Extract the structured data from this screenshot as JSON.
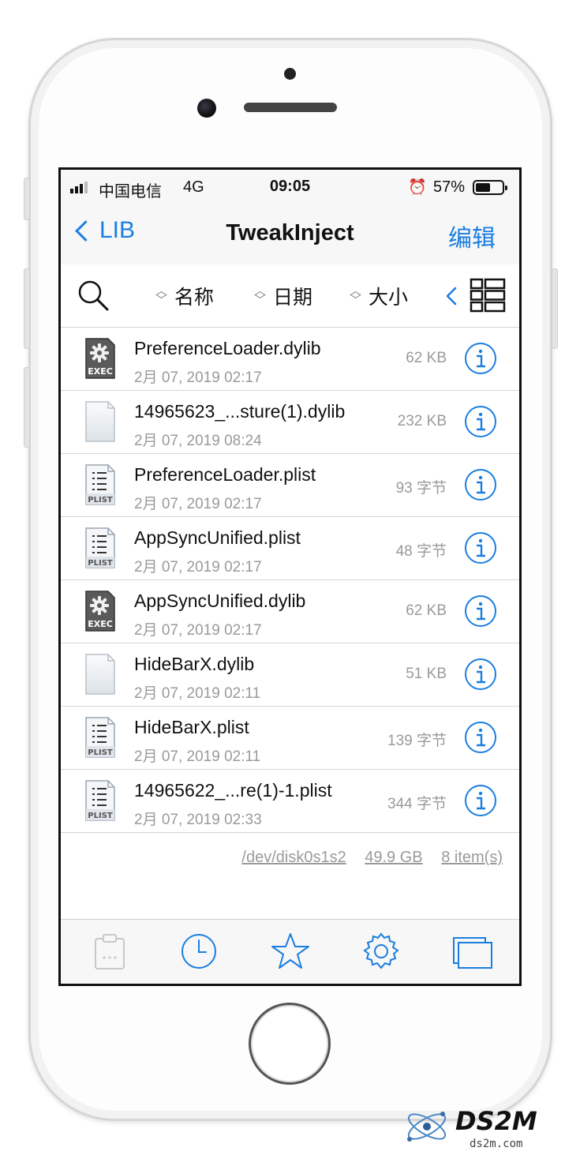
{
  "status_bar": {
    "carrier": "中国电信",
    "network": "4G",
    "time": "09:05",
    "alarm_icon": "alarm-clock-icon",
    "battery_percent": "57%",
    "battery_level": 0.57
  },
  "nav": {
    "back_label": "LIB",
    "title": "TweakInject",
    "edit_label": "编辑"
  },
  "toolbar": {
    "sort_name": "名称",
    "sort_date": "日期",
    "sort_size": "大小"
  },
  "files": [
    {
      "name": "PreferenceLoader.dylib",
      "date": "2月 07, 2019 02:17",
      "size": "62 KB",
      "icon": "exec-file-icon"
    },
    {
      "name": "14965623_...sture(1).dylib",
      "date": "2月 07, 2019 08:24",
      "size": "232 KB",
      "icon": "blank-file-icon"
    },
    {
      "name": "PreferenceLoader.plist",
      "date": "2月 07, 2019 02:17",
      "size": "93 字节",
      "icon": "plist-file-icon"
    },
    {
      "name": "AppSyncUnified.plist",
      "date": "2月 07, 2019 02:17",
      "size": "48 字节",
      "icon": "plist-file-icon"
    },
    {
      "name": "AppSyncUnified.dylib",
      "date": "2月 07, 2019 02:17",
      "size": "62 KB",
      "icon": "exec-file-icon"
    },
    {
      "name": "HideBarX.dylib",
      "date": "2月 07, 2019 02:11",
      "size": "51 KB",
      "icon": "blank-file-icon"
    },
    {
      "name": "HideBarX.plist",
      "date": "2月 07, 2019 02:11",
      "size": "139 字节",
      "icon": "plist-file-icon"
    },
    {
      "name": "14965622_...re(1)-1.plist",
      "date": "2月 07, 2019 02:33",
      "size": "344 字节",
      "icon": "plist-file-icon"
    }
  ],
  "file_icon_labels": {
    "exec": "EXEC",
    "plist": "PLIST"
  },
  "footer": {
    "device": "/dev/disk0s1s2",
    "capacity": "49.9 GB",
    "count": "8 item(s)"
  },
  "tabs": [
    "clipboard-icon",
    "clock-icon",
    "star-icon",
    "gear-icon",
    "windows-icon"
  ],
  "watermark": {
    "brand": "DS2M",
    "domain": "ds2m.com"
  },
  "colors": {
    "accent": "#1a7ee0",
    "secondary_text": "#9a9a9a"
  }
}
